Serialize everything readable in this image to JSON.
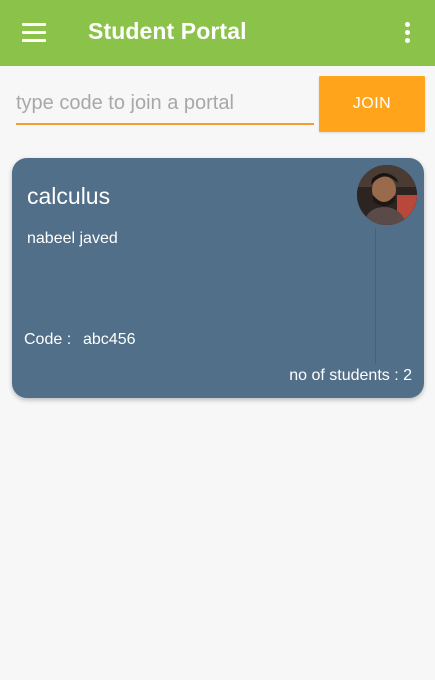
{
  "app": {
    "title": "Student Portal",
    "primary_color": "#8bc34a",
    "accent_color": "#ffa41b",
    "card_color": "#516f88"
  },
  "header": {
    "menu_icon": "hamburger-menu-icon",
    "overflow_icon": "more-vertical-icon"
  },
  "join": {
    "input_value": "",
    "input_placeholder": "type code to join a portal",
    "button_label": "JOIN"
  },
  "portals": [
    {
      "course": "calculus",
      "teacher": "nabeel javed",
      "code_label": "Code :",
      "code": "abc456",
      "students_text": "no of students : 2"
    }
  ]
}
